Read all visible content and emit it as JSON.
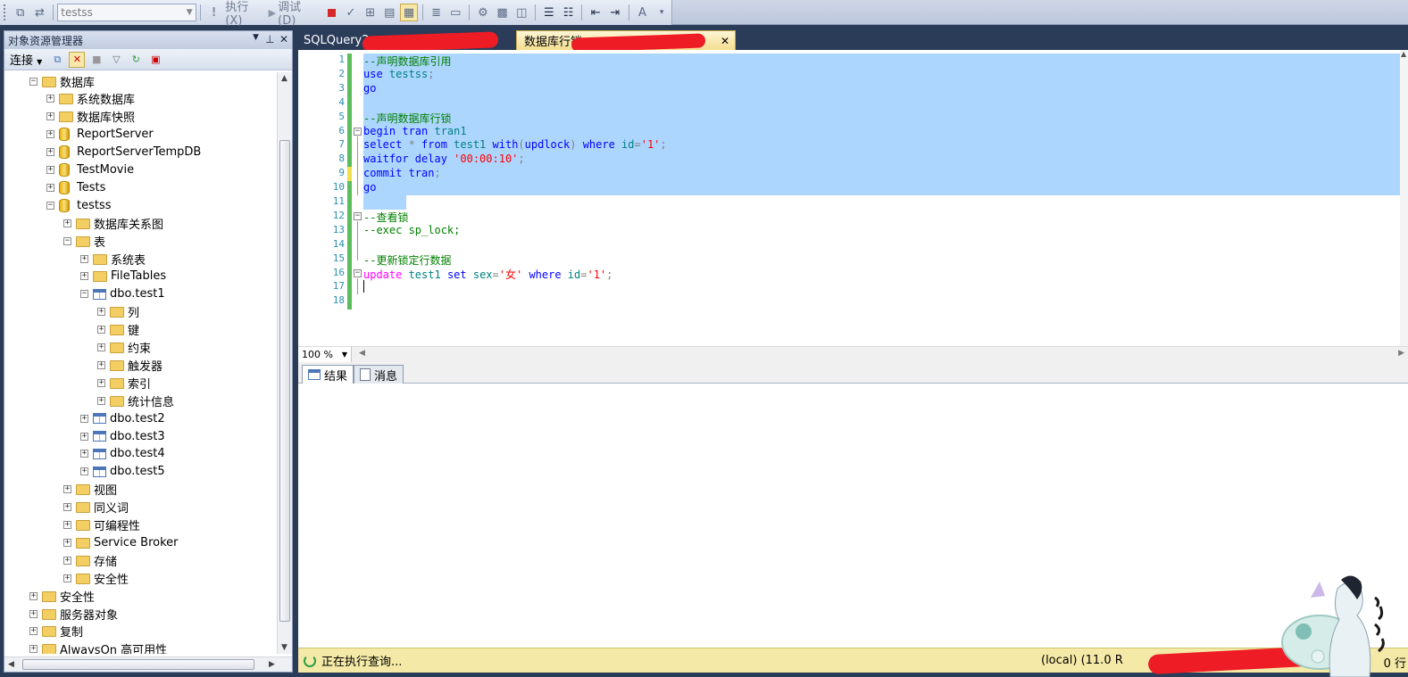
{
  "toolbar": {
    "database_selector": "testss",
    "execute_label": "执行(X)",
    "debug_label": "调试(D)"
  },
  "object_explorer": {
    "title": "对象资源管理器",
    "connect_label": "连接",
    "tree": [
      {
        "label": "数据库",
        "level": 1,
        "expander": "−",
        "icon": "folder-icon"
      },
      {
        "label": "系统数据库",
        "level": 2,
        "expander": "+",
        "icon": "folder-icon"
      },
      {
        "label": "数据库快照",
        "level": 2,
        "expander": "+",
        "icon": "folder-icon"
      },
      {
        "label": "ReportServer",
        "level": 2,
        "expander": "+",
        "icon": "database-icon"
      },
      {
        "label": "ReportServerTempDB",
        "level": 2,
        "expander": "+",
        "icon": "database-icon"
      },
      {
        "label": "TestMovie",
        "level": 2,
        "expander": "+",
        "icon": "database-icon"
      },
      {
        "label": "Tests",
        "level": 2,
        "expander": "+",
        "icon": "database-icon"
      },
      {
        "label": "testss",
        "level": 2,
        "expander": "−",
        "icon": "database-icon"
      },
      {
        "label": "数据库关系图",
        "level": 3,
        "expander": "+",
        "icon": "folder-icon"
      },
      {
        "label": "表",
        "level": 3,
        "expander": "−",
        "icon": "folder-icon"
      },
      {
        "label": "系统表",
        "level": 4,
        "expander": "+",
        "icon": "folder-icon"
      },
      {
        "label": "FileTables",
        "level": 4,
        "expander": "+",
        "icon": "folder-icon"
      },
      {
        "label": "dbo.test1",
        "level": 4,
        "expander": "−",
        "icon": "table-icon"
      },
      {
        "label": "列",
        "level": 5,
        "expander": "+",
        "icon": "folder-icon"
      },
      {
        "label": "键",
        "level": 5,
        "expander": "+",
        "icon": "folder-icon"
      },
      {
        "label": "约束",
        "level": 5,
        "expander": "+",
        "icon": "folder-icon"
      },
      {
        "label": "触发器",
        "level": 5,
        "expander": "+",
        "icon": "folder-icon"
      },
      {
        "label": "索引",
        "level": 5,
        "expander": "+",
        "icon": "folder-icon"
      },
      {
        "label": "统计信息",
        "level": 5,
        "expander": "+",
        "icon": "folder-icon"
      },
      {
        "label": "dbo.test2",
        "level": 4,
        "expander": "+",
        "icon": "table-icon"
      },
      {
        "label": "dbo.test3",
        "level": 4,
        "expander": "+",
        "icon": "table-icon"
      },
      {
        "label": "dbo.test4",
        "level": 4,
        "expander": "+",
        "icon": "table-icon"
      },
      {
        "label": "dbo.test5",
        "level": 4,
        "expander": "+",
        "icon": "table-icon"
      },
      {
        "label": "视图",
        "level": 3,
        "expander": "+",
        "icon": "folder-icon"
      },
      {
        "label": "同义词",
        "level": 3,
        "expander": "+",
        "icon": "folder-icon"
      },
      {
        "label": "可编程性",
        "level": 3,
        "expander": "+",
        "icon": "folder-icon"
      },
      {
        "label": "Service Broker",
        "level": 3,
        "expander": "+",
        "icon": "folder-icon"
      },
      {
        "label": "存储",
        "level": 3,
        "expander": "+",
        "icon": "folder-icon"
      },
      {
        "label": "安全性",
        "level": 3,
        "expander": "+",
        "icon": "folder-icon"
      },
      {
        "label": "安全性",
        "level": 1,
        "expander": "+",
        "icon": "folder-icon"
      },
      {
        "label": "服务器对象",
        "level": 1,
        "expander": "+",
        "icon": "folder-icon"
      },
      {
        "label": "复制",
        "level": 1,
        "expander": "+",
        "icon": "folder-icon"
      },
      {
        "label": "AlwaysOn 高可用性",
        "level": 1,
        "expander": "+",
        "icon": "folder-icon"
      }
    ]
  },
  "editor_tabs": [
    {
      "label": "SQLQuery2",
      "active": false
    },
    {
      "label": "数据库行锁.sc",
      "active": true
    }
  ],
  "editor": {
    "line_numbers": [
      "1",
      "2",
      "3",
      "4",
      "5",
      "6",
      "7",
      "8",
      "9",
      "10",
      "11",
      "12",
      "13",
      "14",
      "15",
      "16",
      "17",
      "18"
    ],
    "lines": [
      {
        "segments": [
          {
            "t": "--声明数据库引用",
            "c": "c"
          }
        ]
      },
      {
        "segments": [
          {
            "t": "use ",
            "c": "k"
          },
          {
            "t": "testss",
            "c": "t"
          },
          {
            "t": ";",
            "c": "g"
          }
        ]
      },
      {
        "segments": [
          {
            "t": "go",
            "c": "k"
          }
        ]
      },
      {
        "segments": []
      },
      {
        "segments": [
          {
            "t": "--声明数据库行锁",
            "c": "c"
          }
        ]
      },
      {
        "segments": [
          {
            "t": "begin tran ",
            "c": "k"
          },
          {
            "t": "tran1",
            "c": "t"
          }
        ]
      },
      {
        "segments": [
          {
            "t": "select ",
            "c": "k"
          },
          {
            "t": "* ",
            "c": "g"
          },
          {
            "t": "from ",
            "c": "k"
          },
          {
            "t": "test1 ",
            "c": "t"
          },
          {
            "t": "with",
            "c": "k"
          },
          {
            "t": "(",
            "c": "g"
          },
          {
            "t": "updlock",
            "c": "k"
          },
          {
            "t": ") ",
            "c": "g"
          },
          {
            "t": "where ",
            "c": "k"
          },
          {
            "t": "id",
            "c": "t"
          },
          {
            "t": "=",
            "c": "g"
          },
          {
            "t": "'1'",
            "c": "s"
          },
          {
            "t": ";",
            "c": "g"
          }
        ]
      },
      {
        "segments": [
          {
            "t": "waitfor delay ",
            "c": "k"
          },
          {
            "t": "'00:00:10'",
            "c": "s"
          },
          {
            "t": ";",
            "c": "g"
          }
        ]
      },
      {
        "segments": [
          {
            "t": "commit tran",
            "c": "k"
          },
          {
            "t": ";",
            "c": "g"
          }
        ]
      },
      {
        "segments": [
          {
            "t": "go",
            "c": "k"
          }
        ]
      },
      {
        "segments": []
      },
      {
        "segments": [
          {
            "t": "--查看锁",
            "c": "c"
          }
        ]
      },
      {
        "segments": [
          {
            "t": "--exec sp_lock;",
            "c": "c"
          }
        ]
      },
      {
        "segments": []
      },
      {
        "segments": [
          {
            "t": "--更新锁定行数据",
            "c": "c"
          }
        ]
      },
      {
        "segments": [
          {
            "t": "update ",
            "c": "m"
          },
          {
            "t": "test1 ",
            "c": "t"
          },
          {
            "t": "set ",
            "c": "k"
          },
          {
            "t": "sex",
            "c": "t"
          },
          {
            "t": "=",
            "c": "g"
          },
          {
            "t": "'女'",
            "c": "s"
          },
          {
            "t": " where ",
            "c": "k"
          },
          {
            "t": "id",
            "c": "t"
          },
          {
            "t": "=",
            "c": "g"
          },
          {
            "t": "'1'",
            "c": "s"
          },
          {
            "t": ";",
            "c": "g"
          }
        ]
      },
      {
        "segments": []
      },
      {
        "segments": []
      }
    ],
    "zoom": "100 %"
  },
  "results_tabs": [
    {
      "label": "结果",
      "active": true
    },
    {
      "label": "消息",
      "active": false
    }
  ],
  "statusbar": {
    "status_text": "正在执行查询...",
    "server_text": "(local) (11.0 R",
    "rows_text": "0 行"
  },
  "colors": {
    "selection": "#add6ff",
    "status_background": "#f4e9a6",
    "change_marker_saved": "#5bbd5b",
    "change_marker_unsaved": "#f2e04a"
  }
}
